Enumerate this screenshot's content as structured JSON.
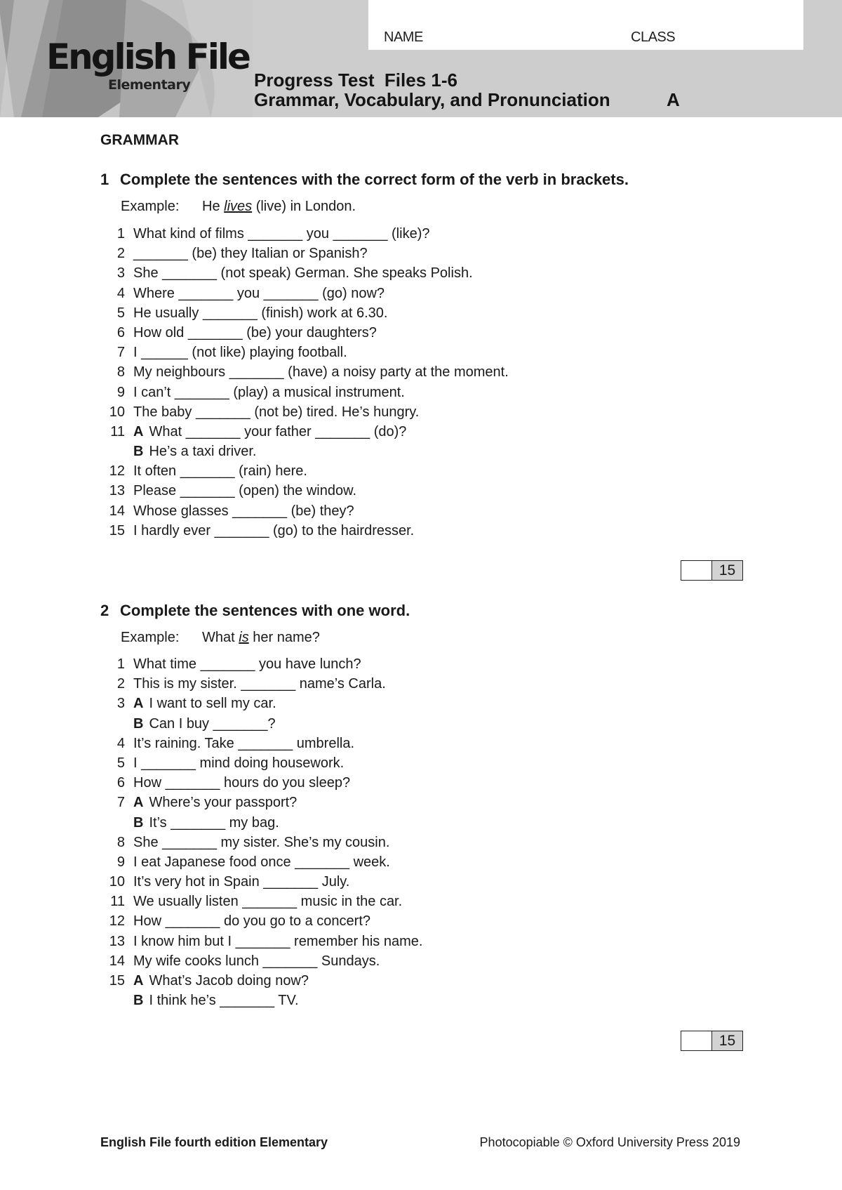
{
  "header": {
    "logo_title": "English File",
    "logo_subtitle": "Elementary",
    "name_label": "NAME",
    "class_label": "CLASS",
    "title_line1": "Progress Test  Files 1-6",
    "title_line2": "Grammar, Vocabulary, and Pronunciation",
    "version": "A"
  },
  "section": {
    "title": "GRAMMAR"
  },
  "exercise1": {
    "number": "1",
    "instruction": "Complete the sentences with the correct form of the verb in brackets.",
    "example_label": "Example:",
    "example_before": "He ",
    "example_answer": "lives",
    "example_after": " (live) in London.",
    "items": [
      {
        "n": "1",
        "text": "What kind of films _______ you _______ (like)?"
      },
      {
        "n": "2",
        "text": "_______ (be) they Italian or Spanish?"
      },
      {
        "n": "3",
        "text": "She _______ (not speak) German. She speaks Polish."
      },
      {
        "n": "4",
        "text": "Where _______ you _______ (go) now?"
      },
      {
        "n": "5",
        "text": "He usually _______ (finish) work at 6.30."
      },
      {
        "n": "6",
        "text": "How old _______ (be) your daughters?"
      },
      {
        "n": "7",
        "text": "I ______ (not like) playing football."
      },
      {
        "n": "8",
        "text": "My neighbours _______ (have) a noisy party at the moment."
      },
      {
        "n": "9",
        "text": "I can’t _______ (play) a musical instrument."
      },
      {
        "n": "10",
        "text": "The baby _______ (not be) tired. He’s hungry."
      },
      {
        "n": "11",
        "speaker": "A",
        "text": "What _______ your father _______ (do)?"
      },
      {
        "n": "",
        "speaker": "B",
        "text": "He’s a taxi driver."
      },
      {
        "n": "12",
        "text": "It often _______ (rain) here."
      },
      {
        "n": "13",
        "text": "Please _______ (open) the window."
      },
      {
        "n": "14",
        "text": "Whose glasses _______ (be) they?"
      },
      {
        "n": "15",
        "text": "I hardly ever _______ (go) to the hairdresser."
      }
    ],
    "score_max": "15"
  },
  "exercise2": {
    "number": "2",
    "instruction": "Complete the sentences with one word.",
    "example_label": "Example:",
    "example_before": "What ",
    "example_answer": "is",
    "example_after": " her name?",
    "items": [
      {
        "n": "1",
        "text": "What time _______ you have lunch?"
      },
      {
        "n": "2",
        "text": "This is my sister. _______ name’s Carla."
      },
      {
        "n": "3",
        "speaker": "A",
        "text": "I want to sell my car."
      },
      {
        "n": "",
        "speaker": "B",
        "text": "Can I buy _______?"
      },
      {
        "n": "4",
        "text": "It’s raining. Take _______ umbrella."
      },
      {
        "n": "5",
        "text": "I _______ mind doing housework."
      },
      {
        "n": "6",
        "text": "How _______ hours do you sleep?"
      },
      {
        "n": "7",
        "speaker": "A",
        "text": "Where’s your passport?"
      },
      {
        "n": "",
        "speaker": "B",
        "text": "It’s _______ my bag."
      },
      {
        "n": "8",
        "text": "She _______ my sister. She’s my cousin."
      },
      {
        "n": "9",
        "text": "I eat Japanese food once _______ week."
      },
      {
        "n": "10",
        "text": "It’s very hot in Spain _______ July."
      },
      {
        "n": "11",
        "text": "We usually listen _______ music in the car."
      },
      {
        "n": "12",
        "text": "How _______ do you go to a concert?"
      },
      {
        "n": "13",
        "text": "I know him but I _______ remember his name."
      },
      {
        "n": "14",
        "text": "My wife cooks lunch _______ Sundays."
      },
      {
        "n": "15",
        "speaker": "A",
        "text": "What’s Jacob doing now?"
      },
      {
        "n": "",
        "speaker": "B",
        "text": "I think he’s _______ TV."
      }
    ],
    "score_max": "15"
  },
  "footer": {
    "left": "English File fourth edition Elementary",
    "right": "Photocopiable © Oxford University Press 2019"
  }
}
